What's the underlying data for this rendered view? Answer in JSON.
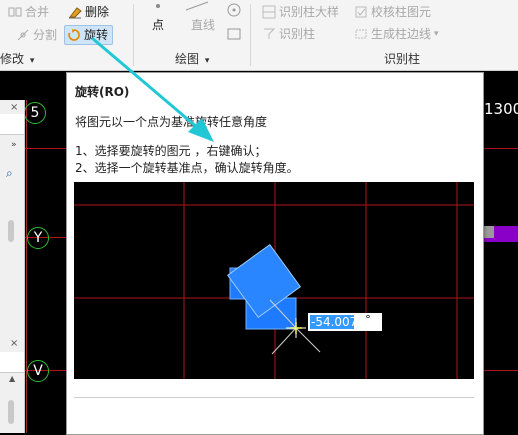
{
  "ribbon": {
    "modify": {
      "merge_label": "合并",
      "delete_label": "删除",
      "split_label": "分割",
      "rotate_label": "旋转",
      "group_label": "修改"
    },
    "draw": {
      "point_label": "点",
      "line_label": "直线",
      "group_label": "绘图"
    },
    "identify_column": {
      "column_schedule_label": "识别柱大样",
      "check_column_label": "校核柱图元",
      "identify_column_label": "识别柱",
      "generate_edge_label": "生成柱边线",
      "group_label": "识别柱"
    }
  },
  "cad": {
    "axis_y": "Y",
    "axis_v": "V",
    "axis_top": "5",
    "dimension_text": "1300"
  },
  "tooltip": {
    "title": "旋转(RO)",
    "description": "将图元以一个点为基准旋转任意角度",
    "step1": "1、选择要旋转的图元 ，右键确认；",
    "step2": "2、选择一个旋转基准点，确认旋转角度。",
    "angle_value": "-54.007",
    "degree_symbol": "°"
  },
  "colors": {
    "grid_red": "#b0141a",
    "axis_green": "#2fbf2f",
    "shape_blue": "#1e7bff",
    "arrow_cyan": "#22c7d6",
    "highlight_purple": "#8a00c8"
  }
}
